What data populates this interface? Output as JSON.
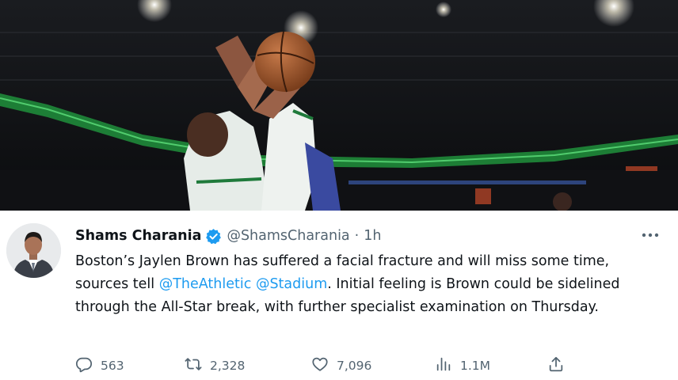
{
  "media": {
    "alt_icon": "basketball-game-photo"
  },
  "tweet": {
    "display_name": "Shams Charania",
    "handle": "@ShamsCharania",
    "separator": "·",
    "time": "1h",
    "text_before": "Boston’s Jaylen Brown has suffered a facial fracture and will miss some time, sources tell ",
    "mention_1": "@TheAthletic",
    "space": " ",
    "mention_2": "@Stadium",
    "text_after": ". Initial feeling is Brown could be sidelined through the All-Star break, with further specialist examination on Thursday.",
    "verified_color": "#1d9bf0",
    "link_color": "#1d9bf0"
  },
  "actions": {
    "reply_count": "563",
    "retweet_count": "2,328",
    "like_count": "7,096",
    "views_count": "1.1M",
    "reply_icon": "reply-icon",
    "retweet_icon": "retweet-icon",
    "like_icon": "heart-icon",
    "views_icon": "views-chart-icon",
    "share_icon": "share-icon"
  }
}
